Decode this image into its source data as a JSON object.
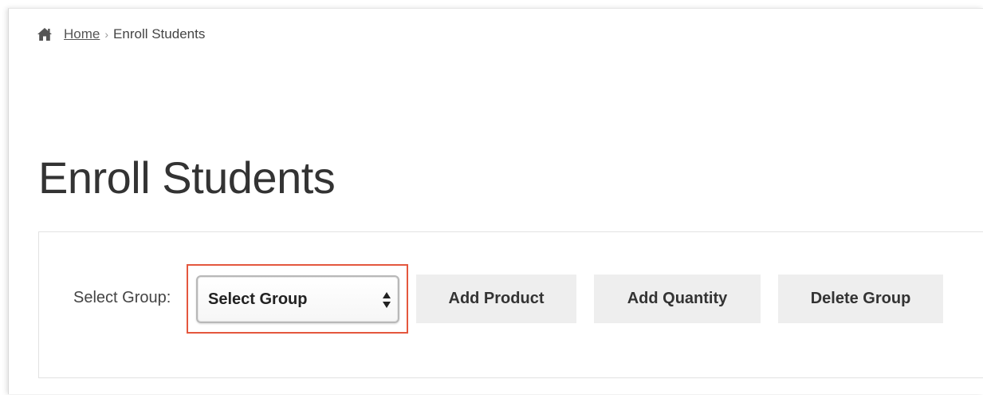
{
  "breadcrumb": {
    "home_label": "Home",
    "separator": "›",
    "current": "Enroll Students",
    "icon": "home-icon"
  },
  "page": {
    "title": "Enroll Students"
  },
  "form": {
    "select_label": "Select Group:",
    "select_value": "Select Group",
    "highlight_color": "#e4573e"
  },
  "buttons": {
    "add_product": "Add Product",
    "add_quantity": "Add Quantity",
    "delete_group": "Delete Group"
  }
}
